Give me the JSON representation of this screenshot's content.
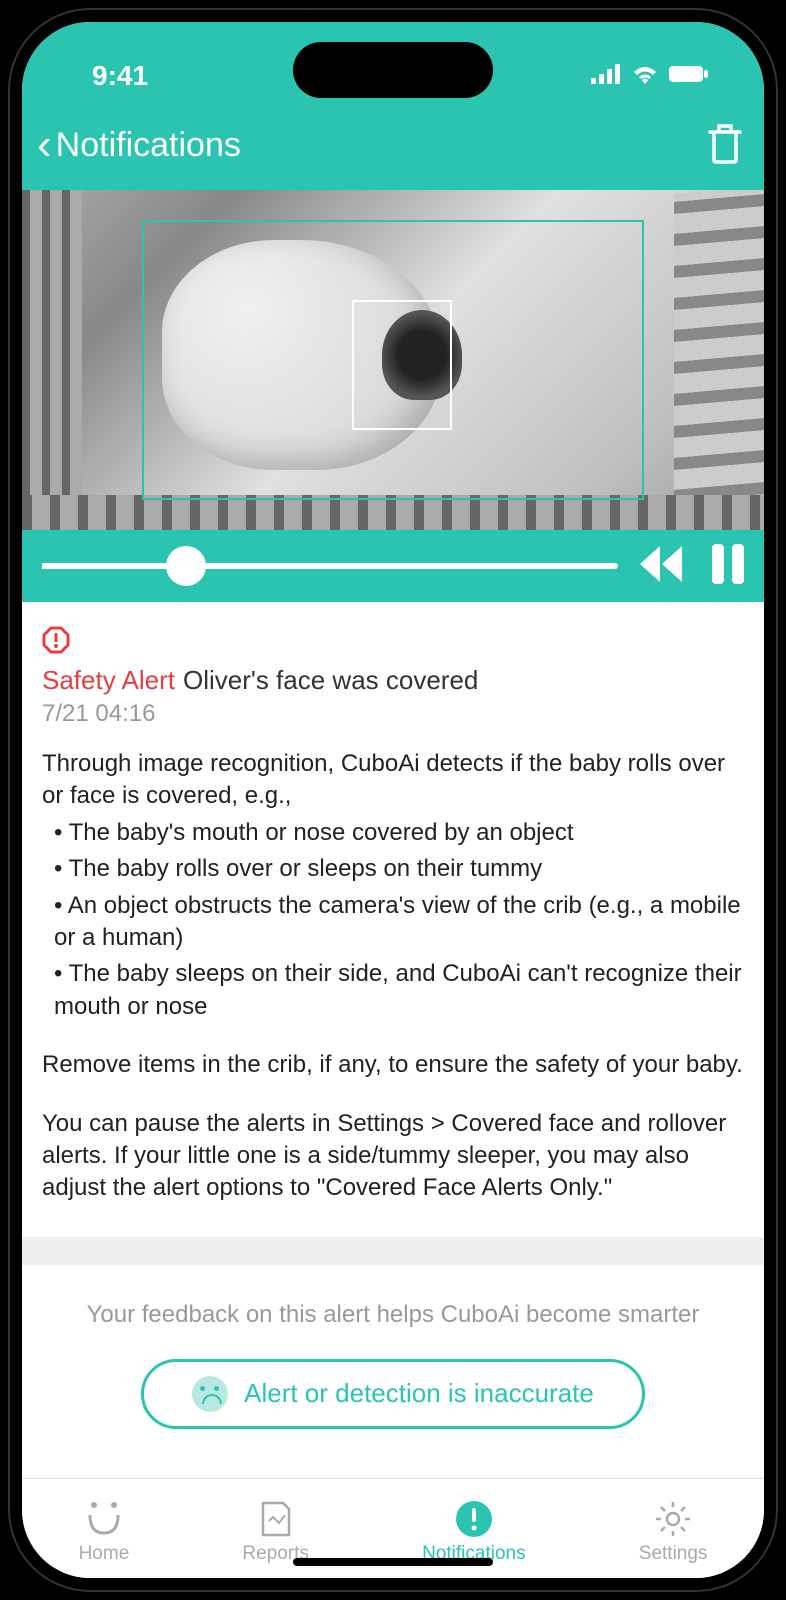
{
  "status": {
    "time": "9:41"
  },
  "header": {
    "back_label": "Notifications"
  },
  "player": {
    "progress_percent": 25
  },
  "alert": {
    "label": "Safety Alert",
    "message": "Oliver's face was covered",
    "timestamp": "7/21 04:16",
    "body_intro": "Through image recognition, CuboAi detects if the baby rolls over or face is covered, e.g.,",
    "bullet1": " • The baby's mouth or nose covered by an object",
    "bullet2": " • The baby rolls over or sleeps on their tummy",
    "bullet3": " • An object obstructs the camera's view of the crib (e.g., a mobile or a human)",
    "bullet4": " • The baby sleeps on their side, and CuboAi can't recognize their mouth or nose",
    "body_advice": "Remove items in the crib, if any, to ensure the safety of your baby.",
    "body_settings": "You can pause the alerts in Settings > Covered face and rollover alerts. If your little one is a side/tummy sleeper, you may also adjust the alert options to \"Covered Face Alerts Only.\""
  },
  "feedback": {
    "prompt": "Your feedback on this alert helps CuboAi become smarter",
    "button_label": "Alert or detection is inaccurate"
  },
  "tabs": {
    "home": "Home",
    "reports": "Reports",
    "notifications": "Notifications",
    "settings": "Settings"
  }
}
